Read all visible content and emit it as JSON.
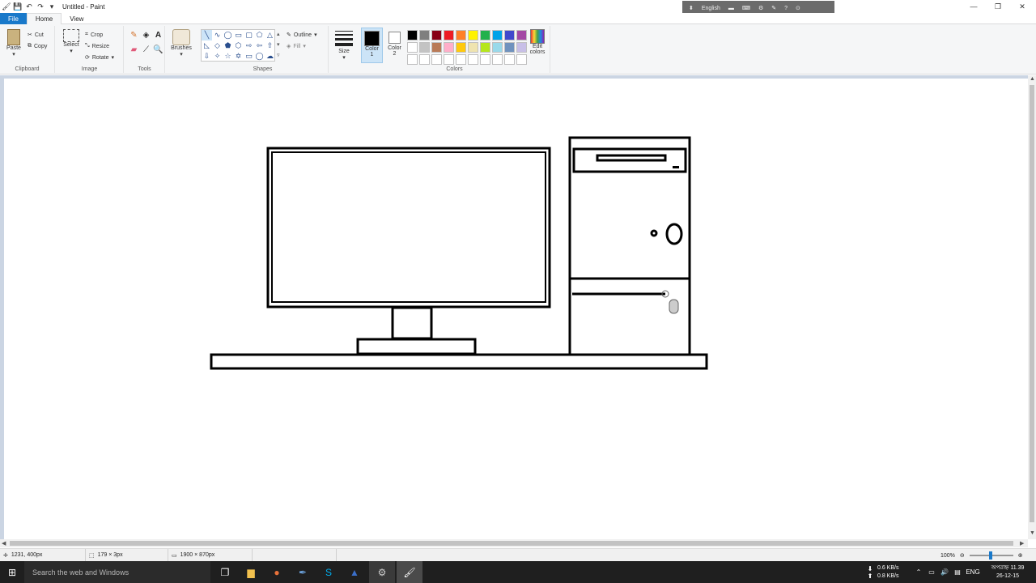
{
  "window": {
    "title": "Untitled - Paint",
    "controls": [
      "minimize",
      "maximize",
      "close"
    ]
  },
  "language_bar": {
    "label": "English"
  },
  "tabs": [
    {
      "label": "File",
      "active": false
    },
    {
      "label": "Home",
      "active": true
    },
    {
      "label": "View",
      "active": false
    }
  ],
  "ribbon": {
    "clipboard": {
      "group_label": "Clipboard",
      "paste": "Paste",
      "cut": "Cut",
      "copy": "Copy"
    },
    "image": {
      "group_label": "Image",
      "select": "Select",
      "crop": "Crop",
      "resize": "Resize",
      "rotate": "Rotate"
    },
    "tools": {
      "group_label": "Tools"
    },
    "brushes": {
      "label": "Brushes"
    },
    "shapes": {
      "group_label": "Shapes",
      "outline": "Outline",
      "fill": "Fill"
    },
    "size": {
      "label": "Size"
    },
    "colors": {
      "group_label": "Colors",
      "color1": "Color 1",
      "color1_lines": [
        "Color",
        "1"
      ],
      "color2_lines": [
        "Color",
        "2"
      ],
      "color1_value": "#000000",
      "color2_value": "#ffffff",
      "edit_colors_lines": [
        "Edit",
        "colors"
      ],
      "palette": [
        "#000000",
        "#7f7f7f",
        "#880015",
        "#ed1c24",
        "#ff7f27",
        "#fff200",
        "#22b14c",
        "#00a2e8",
        "#3f48cc",
        "#a349a4",
        "#ffffff",
        "#c3c3c3",
        "#b97a57",
        "#ffaec9",
        "#ffc90e",
        "#efe4b0",
        "#b5e61d",
        "#99d9ea",
        "#7092be",
        "#c8bfe7",
        "#ffffff",
        "#ffffff",
        "#ffffff",
        "#ffffff",
        "#ffffff",
        "#ffffff",
        "#ffffff",
        "#ffffff",
        "#ffffff",
        "#ffffff"
      ]
    }
  },
  "status": {
    "cursor_position": "1231, 400px",
    "selection_size": "179 × 3px",
    "image_size": "1900 × 870px",
    "zoom": "100%"
  },
  "taskbar": {
    "search_placeholder": "Search the web and Windows",
    "net_down": "0.6 KB/s",
    "net_up": "0.8 KB/s",
    "language": "ENG",
    "time": "অপরাহ্ন 11.39",
    "date": "26-12-15"
  }
}
